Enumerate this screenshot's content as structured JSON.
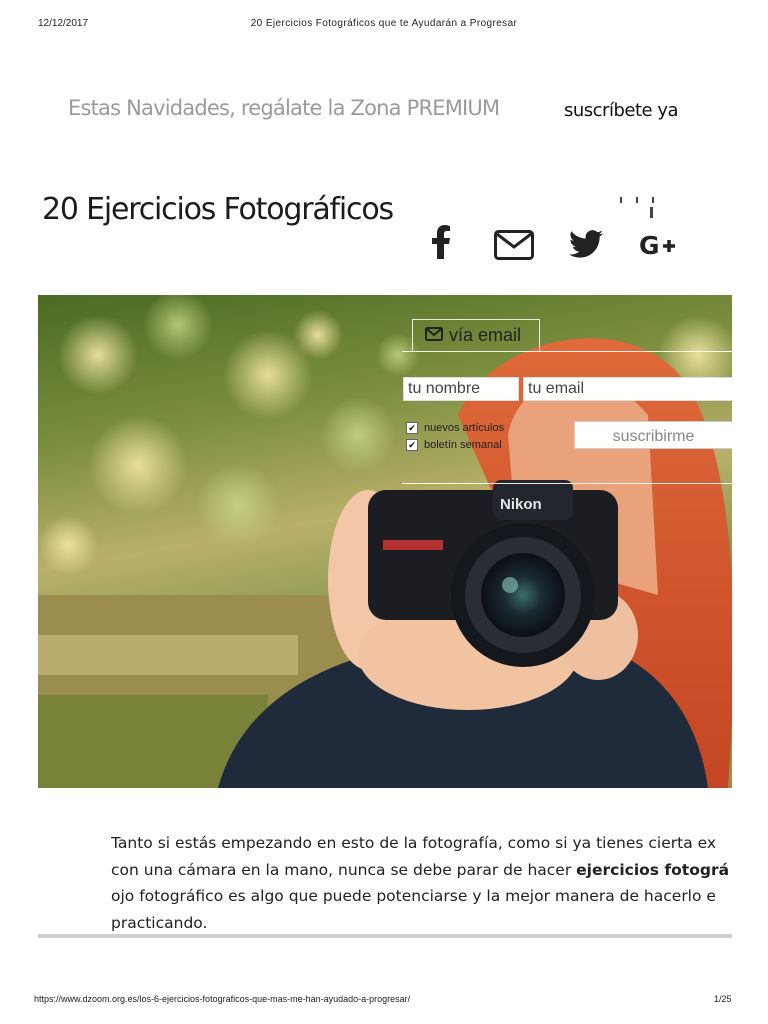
{
  "print_header": {
    "date": "12/12/2017",
    "title": "20 Ejercicios Fotográficos que te Ayudarán a Progresar"
  },
  "promo": {
    "text": "Estas Navidades, regálate la Zona PREMIUM",
    "cta": "suscríbete ya"
  },
  "article": {
    "title": "20 Ejercicios Fotográficos",
    "paragraph": {
      "line1": "Tanto si estás empezando en esto de la fotografía, como si ya tienes cierta ex",
      "line2_before": "con una cámara en la mano, nunca se debe parar de hacer ",
      "line2_bold": "ejercicios fotográ",
      "line3": "ojo fotográfico es algo que puede potenciarse y la mejor manera de hacerlo e",
      "line4": "practicando."
    }
  },
  "social": {
    "icons": [
      "facebook-icon",
      "mail-icon",
      "twitter-icon",
      "google-plus-icon"
    ]
  },
  "subscribe": {
    "tab_label": "vía email",
    "name_placeholder": "tu nombre",
    "email_placeholder": "tu email",
    "options": [
      {
        "label": "nuevos artículos",
        "checked": true
      },
      {
        "label": "boletín semanal",
        "checked": true
      }
    ],
    "button_label": "suscribirme"
  },
  "print_footer": {
    "url": "https://www.dzoom.org.es/los-6-ejercicios-fotograficos-que-mas-me-han-ayudado-a-progresar/",
    "page": "1/25"
  },
  "colors": {
    "promo_gray": "#9a9a9a",
    "hair_red": "#d9532b",
    "jacket_navy": "#1f2a3a"
  }
}
